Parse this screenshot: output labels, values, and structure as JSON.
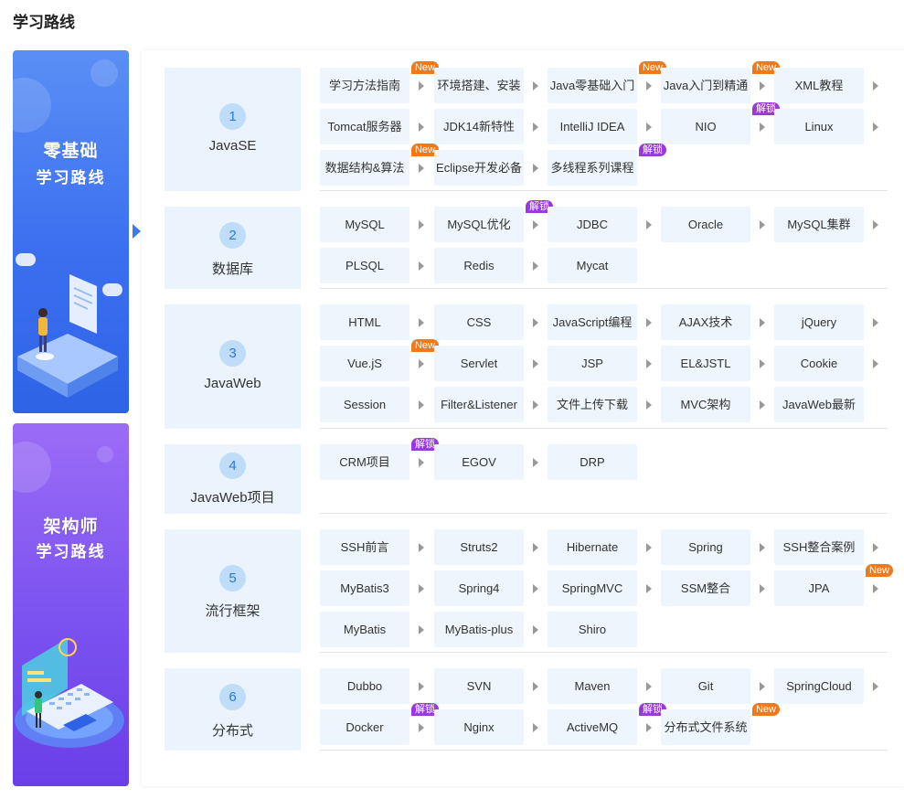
{
  "page_title": "学习路线",
  "banners": [
    {
      "line1": "零基础",
      "line2": "学习路线"
    },
    {
      "line1": "架构师",
      "line2": "学习路线"
    }
  ],
  "badge_colors": {
    "new": "#f07a1b",
    "lock": "#9a3ad6"
  },
  "sections": [
    {
      "num": "1",
      "name": "JavaSE",
      "items": [
        {
          "label": "学习方法指南",
          "badge": "New",
          "badge_type": "new"
        },
        {
          "label": "环境搭建、安装"
        },
        {
          "label": "Java零基础入门",
          "badge": "New",
          "badge_type": "new"
        },
        {
          "label": "Java入门到精通",
          "badge": "New",
          "badge_type": "new"
        },
        {
          "label": "XML教程"
        },
        {
          "label": "Tomcat服务器"
        },
        {
          "label": "JDK14新特性"
        },
        {
          "label": "IntelliJ IDEA"
        },
        {
          "label": "NIO",
          "badge": "解锁",
          "badge_type": "lock"
        },
        {
          "label": "Linux"
        },
        {
          "label": "数据结构&算法",
          "badge": "New",
          "badge_type": "new"
        },
        {
          "label": "Eclipse开发必备"
        },
        {
          "label": "多线程系列课程",
          "badge": "解锁",
          "badge_type": "lock",
          "no_arrow": true
        }
      ]
    },
    {
      "num": "2",
      "name": "数据库",
      "items": [
        {
          "label": "MySQL"
        },
        {
          "label": "MySQL优化",
          "badge": "解锁",
          "badge_type": "lock"
        },
        {
          "label": "JDBC"
        },
        {
          "label": "Oracle"
        },
        {
          "label": "MySQL集群"
        },
        {
          "label": "PLSQL"
        },
        {
          "label": "Redis"
        },
        {
          "label": "Mycat",
          "no_arrow": true
        }
      ]
    },
    {
      "num": "3",
      "name": "JavaWeb",
      "items": [
        {
          "label": "HTML"
        },
        {
          "label": "CSS"
        },
        {
          "label": "JavaScript编程"
        },
        {
          "label": "AJAX技术"
        },
        {
          "label": "jQuery"
        },
        {
          "label": "Vue.jS",
          "badge": "New",
          "badge_type": "new"
        },
        {
          "label": "Servlet"
        },
        {
          "label": "JSP"
        },
        {
          "label": "EL&JSTL"
        },
        {
          "label": "Cookie"
        },
        {
          "label": "Session"
        },
        {
          "label": "Filter&Listener"
        },
        {
          "label": "文件上传下载"
        },
        {
          "label": "MVC架构"
        },
        {
          "label": "JavaWeb最新",
          "no_arrow": true
        }
      ]
    },
    {
      "num": "4",
      "name": "JavaWeb项目",
      "items": [
        {
          "label": "CRM项目",
          "badge": "解锁",
          "badge_type": "lock"
        },
        {
          "label": "EGOV"
        },
        {
          "label": "DRP",
          "no_arrow": true
        }
      ]
    },
    {
      "num": "5",
      "name": "流行框架",
      "items": [
        {
          "label": "SSH前言"
        },
        {
          "label": "Struts2"
        },
        {
          "label": "Hibernate"
        },
        {
          "label": "Spring"
        },
        {
          "label": "SSH整合案例"
        },
        {
          "label": "MyBatis3"
        },
        {
          "label": "Spring4"
        },
        {
          "label": "SpringMVC"
        },
        {
          "label": "SSM整合"
        },
        {
          "label": "JPA",
          "badge": "New",
          "badge_type": "new"
        },
        {
          "label": "MyBatis"
        },
        {
          "label": "MyBatis-plus"
        },
        {
          "label": "Shiro",
          "no_arrow": true
        }
      ]
    },
    {
      "num": "6",
      "name": "分布式",
      "items": [
        {
          "label": "Dubbo"
        },
        {
          "label": "SVN"
        },
        {
          "label": "Maven"
        },
        {
          "label": "Git"
        },
        {
          "label": "SpringCloud"
        },
        {
          "label": "Docker",
          "badge": "解锁",
          "badge_type": "lock"
        },
        {
          "label": "Nginx"
        },
        {
          "label": "ActiveMQ",
          "badge": "解锁",
          "badge_type": "lock"
        },
        {
          "label": "分布式文件系统",
          "badge": "New",
          "badge_type": "new",
          "no_arrow": true
        }
      ]
    }
  ]
}
